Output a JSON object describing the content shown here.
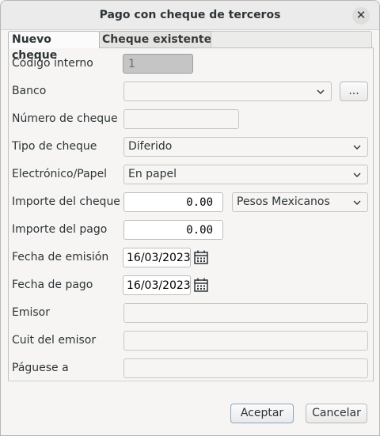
{
  "window": {
    "title": "Pago con cheque de terceros"
  },
  "tabs": [
    {
      "label": "Nuevo cheque"
    },
    {
      "label": "Cheque existente"
    }
  ],
  "form": {
    "codigo_interno": {
      "label": "Código interno",
      "value": "1"
    },
    "banco": {
      "label": "Banco",
      "value": "",
      "more_label": "..."
    },
    "numero_cheque": {
      "label": "Número de cheque",
      "value": ""
    },
    "tipo_cheque": {
      "label": "Tipo de cheque",
      "value": "Diferido"
    },
    "electronico_papel": {
      "label": "Electrónico/Papel",
      "value": "En papel"
    },
    "importe_cheque": {
      "label": "Importe del cheque",
      "value": "0.00",
      "currency": "Pesos Mexicanos"
    },
    "importe_pago": {
      "label": "Importe del pago",
      "value": "0.00"
    },
    "fecha_emision": {
      "label": "Fecha de emisión",
      "value": "16/03/2023"
    },
    "fecha_pago": {
      "label": "Fecha de pago",
      "value": "16/03/2023"
    },
    "emisor": {
      "label": "Emisor",
      "value": ""
    },
    "cuit_emisor": {
      "label": "Cuit del emisor",
      "value": ""
    },
    "paguese_a": {
      "label": "Páguese a",
      "value": ""
    }
  },
  "buttons": {
    "accept": "Aceptar",
    "cancel": "Cancelar"
  },
  "icons": {
    "close": "close-icon",
    "chevron": "chevron-down-icon",
    "calendar": "calendar-icon"
  }
}
